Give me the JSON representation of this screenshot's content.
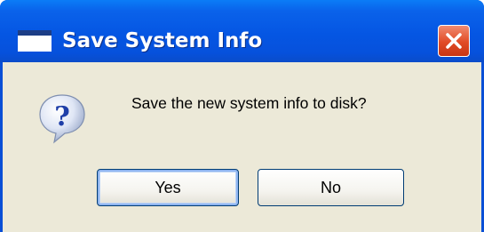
{
  "window": {
    "title": "Save System Info",
    "title_icon": "window-icon"
  },
  "titlebar": {
    "close_icon": "close-icon"
  },
  "dialog": {
    "icon": "question-icon",
    "message": "Save the new system info to disk?",
    "buttons": {
      "yes_label": "Yes",
      "no_label": "No"
    }
  },
  "colors": {
    "titlebar_blue": "#0556e3",
    "close_red": "#e14b26",
    "dialog_background": "#ece9d8",
    "default_button_focus": "#8fb5f0"
  }
}
